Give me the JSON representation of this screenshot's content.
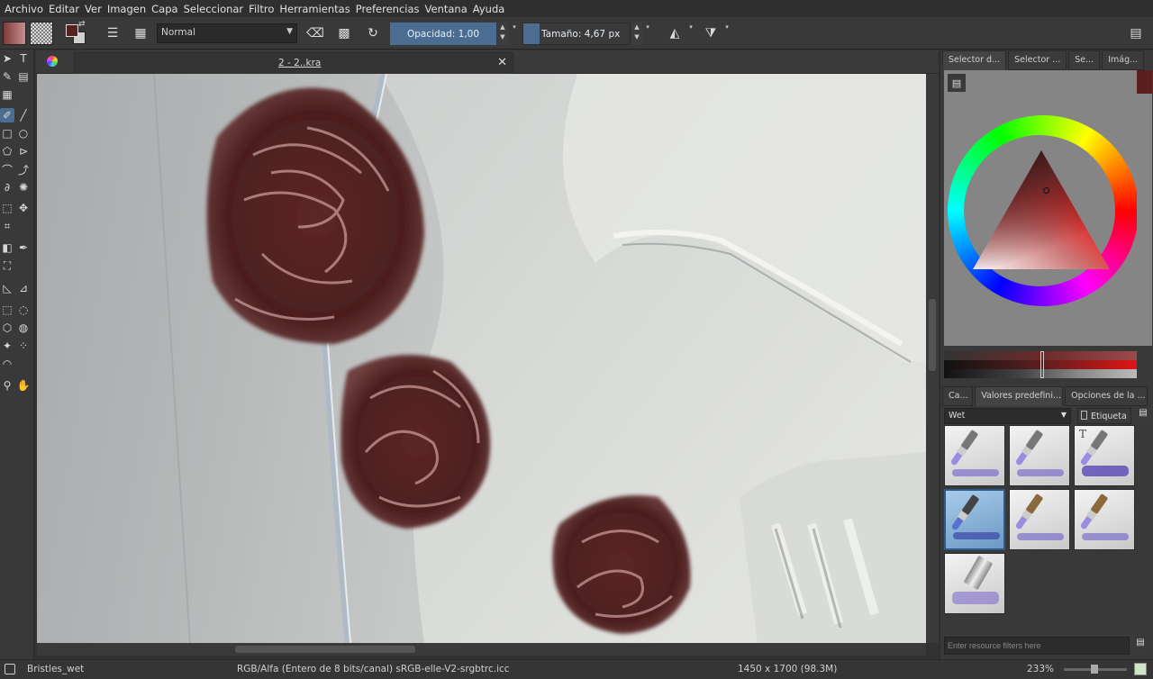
{
  "menu": [
    "Archivo",
    "Editar",
    "Ver",
    "Imagen",
    "Capa",
    "Seleccionar",
    "Filtro",
    "Herramientas",
    "Preferencias",
    "Ventana",
    "Ayuda"
  ],
  "toolbar": {
    "blend_mode": "Normal",
    "opacity_label": "Opacidad:  1,00",
    "size_label": "Tamaño:  4,67 px"
  },
  "document": {
    "tab_title": "2 - 2..kra"
  },
  "docker": {
    "top_tabs": [
      "Selector d...",
      "Selector ...",
      "Se...",
      "Imág..."
    ],
    "bottom_tabs": [
      "Ca...",
      "Valores predefini...",
      "Opciones de la ..."
    ],
    "tag_select": "Wet",
    "tag_button": "Etiqueta",
    "filter_placeholder": "Enter resource filters here"
  },
  "status": {
    "brush": "Bristles_wet",
    "colorspace": "RGB/Alfa (Entero de 8 bits/canal)  sRGB-elle-V2-srgbtrc.icc",
    "dimensions": "1450 x 1700 (98.3M)",
    "zoom": "233%"
  },
  "colors": {
    "foreground": "#5a1f1f",
    "background": "#d0d0d0",
    "accent": "#4b6d92"
  }
}
